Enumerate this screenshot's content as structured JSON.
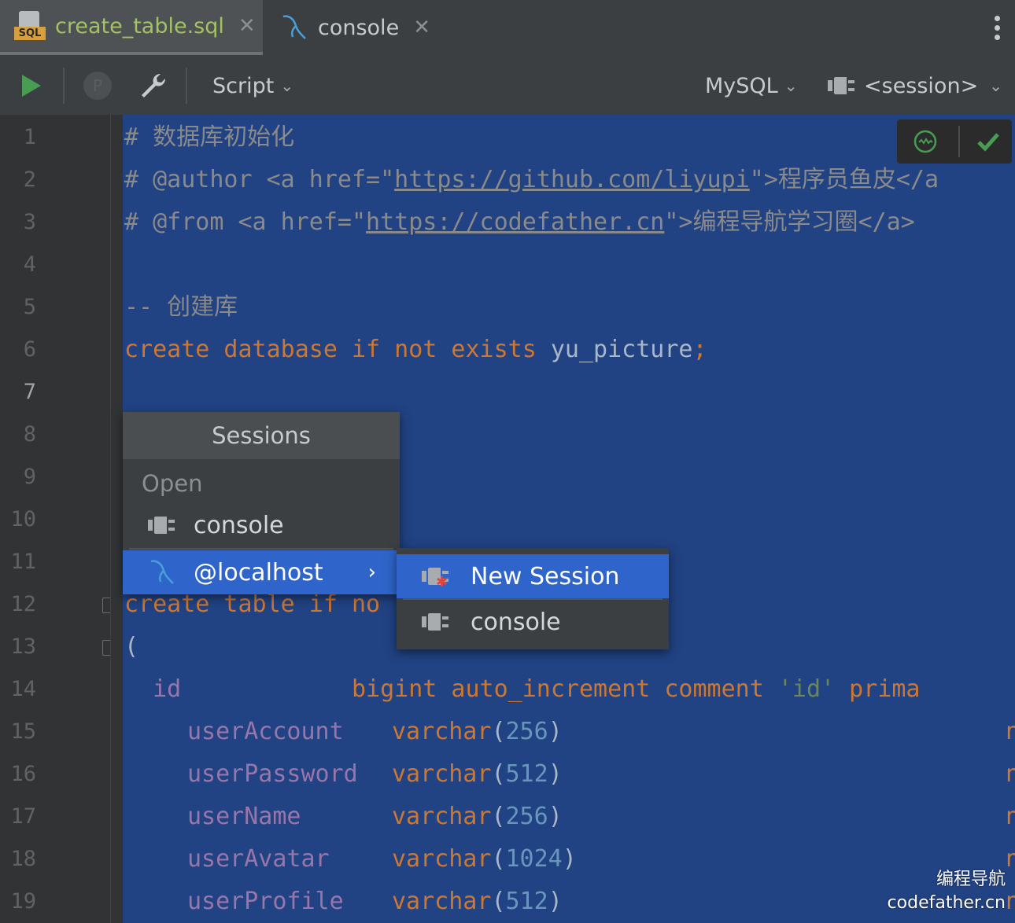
{
  "tabs": [
    {
      "name": "create_table.sql",
      "active": true,
      "icon": "sql-file-icon",
      "icon_label": "SQL"
    },
    {
      "name": "console",
      "active": false,
      "icon": "mysql-dolphin-icon"
    }
  ],
  "toolbar": {
    "script_label": "Script",
    "dialect_label": "MySQL",
    "session_label": "<session>",
    "disabled_icon_letter": "P"
  },
  "code_lines": [
    {
      "n": "1"
    },
    {
      "n": "2"
    },
    {
      "n": "3"
    },
    {
      "n": "4"
    },
    {
      "n": "5"
    },
    {
      "n": "6"
    },
    {
      "n": "7"
    },
    {
      "n": "8"
    },
    {
      "n": "9"
    },
    {
      "n": "10"
    },
    {
      "n": "11"
    },
    {
      "n": "12"
    },
    {
      "n": "13"
    },
    {
      "n": "14"
    },
    {
      "n": "15"
    },
    {
      "n": "16"
    },
    {
      "n": "17"
    },
    {
      "n": "18"
    },
    {
      "n": "19"
    }
  ],
  "code": {
    "l1_hash": "# ",
    "l1_text": "数据库初始化",
    "l2_prefix": "# @author <a href=\"",
    "l2_url": "https://github.com/liyupi",
    "l2_suffix": "\">程序员鱼皮</a",
    "l3_prefix": "# @from <a href=\"",
    "l3_url": "https://codefather.cn",
    "l3_suffix": "\">编程导航学习圈</a>",
    "l5": "-- 创建库",
    "l6_kw": "create database if not exists ",
    "l6_name": "yu_picture",
    "l6_semi": ";",
    "l12": "create table if no",
    "l13": "(",
    "l14_col": "id",
    "l14_type": "bigint auto_increment comment ",
    "l14_str": "'id'",
    "l14_tail": " prima",
    "cols": [
      {
        "name": "userAccount",
        "type": "varchar",
        "size": "256",
        "tail": "n"
      },
      {
        "name": "userPassword",
        "type": "varchar",
        "size": "512",
        "tail": "n"
      },
      {
        "name": "userName",
        "type": "varchar",
        "size": "256",
        "tail": "n"
      },
      {
        "name": "userAvatar",
        "type": "varchar",
        "size": "1024",
        "tail": "n"
      },
      {
        "name": "userProfile",
        "type": "varchar",
        "size": "512",
        "tail": "n"
      }
    ]
  },
  "sessions_popup": {
    "title": "Sessions",
    "group_label": "Open",
    "items": [
      {
        "label": "console"
      },
      {
        "label": "@localhost",
        "selected": true
      }
    ]
  },
  "submenu": {
    "items": [
      {
        "label": "New Session",
        "selected": true
      },
      {
        "label": "console"
      }
    ]
  },
  "watermark": {
    "line1": "编程导航",
    "line2": "codefather.cn"
  },
  "colors": {
    "selection_bg": "#214283",
    "popup_selected": "#2f65ca",
    "run_green": "#499c54",
    "keyword": "#cc7832",
    "identifier": "#9876aa"
  }
}
